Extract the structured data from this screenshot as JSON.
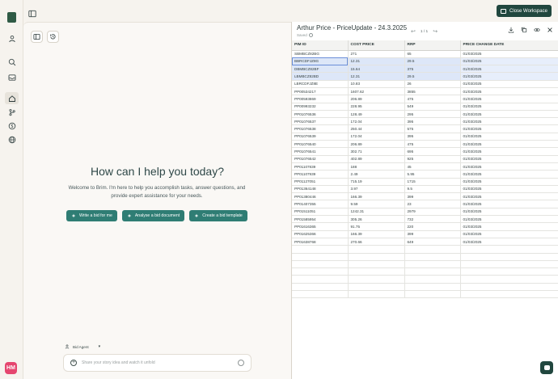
{
  "app": {
    "header": {
      "close_workspace_label": "Close Workspace"
    },
    "user": {
      "initials": "HM"
    }
  },
  "chat": {
    "headline": "How can I help you today?",
    "subtext": "Welcome to Brim. I'm here to help you accomplish tasks, answer questions, and provide expert assistance for your needs.",
    "actions": [
      {
        "label": "Write a bid for me"
      },
      {
        "label": "Analyse a bid document"
      },
      {
        "label": "Create a bid template"
      }
    ],
    "agent_label": "Bid Agent",
    "input_placeholder": "Share your story idea and watch it unfold"
  },
  "panel": {
    "title": "Arthur Price - PriceUpdate - 24.3.2025",
    "status": "Saved",
    "pagination": "1 / 1",
    "columns": [
      "PIM ID",
      "COST PRICE",
      "RRP",
      "PRICE CHANGE DATE"
    ],
    "rows": [
      [
        "SBMBCZ82BG",
        "271",
        "65",
        "01/03/2025"
      ],
      [
        "BBRCDFJZ8G",
        "12.31",
        "29.5",
        "01/03/2025"
      ],
      [
        "DBMBCZ82BF",
        "15.64",
        "375",
        "01/03/2025"
      ],
      [
        "LBMBCZ82BD",
        "12.31",
        "29.5",
        "01/03/2025"
      ],
      [
        "LBRCDFJZ8E",
        "10.83",
        "26",
        "01/03/2025"
      ],
      [
        "PP00534217",
        "1607.62",
        "3855",
        "01/03/2025"
      ],
      [
        "PP00593869",
        "206.89",
        "475",
        "01/03/2025"
      ],
      [
        "PP00993232",
        "228.95",
        "549",
        "01/03/2025"
      ],
      [
        "PP01076536",
        "128.49",
        "295",
        "01/03/2025"
      ],
      [
        "PP01076537",
        "172.04",
        "395",
        "01/03/2025"
      ],
      [
        "PP01076538",
        "250.44",
        "575",
        "01/03/2025"
      ],
      [
        "PP01076539",
        "172.04",
        "395",
        "01/03/2025"
      ],
      [
        "PP01076540",
        "206.89",
        "475",
        "01/03/2025"
      ],
      [
        "PP01076541",
        "302.71",
        "695",
        "01/03/2025"
      ],
      [
        "PP01076542",
        "402.89",
        "925",
        "01/03/2025"
      ],
      [
        "PP01107839",
        "188",
        "45",
        "01/03/2025"
      ],
      [
        "PP01107939",
        "2.49",
        "5.95",
        "01/03/2025"
      ],
      [
        "PP01127051",
        "715.19",
        "1715",
        "01/03/2025"
      ],
      [
        "PP01364148",
        "3.97",
        "9.5",
        "01/03/2025"
      ],
      [
        "PP01380446",
        "166.39",
        "399",
        "01/03/2025"
      ],
      [
        "PP01407355",
        "9.59",
        "23",
        "01/03/2025"
      ],
      [
        "PP01511051",
        "1242.31",
        "2979",
        "01/03/2025"
      ],
      [
        "PP01585954",
        "305.26",
        "732",
        "01/03/2025"
      ],
      [
        "PP01616365",
        "91.75",
        "220",
        "01/03/2025"
      ],
      [
        "PP01625366",
        "166.39",
        "399",
        "01/03/2025"
      ],
      [
        "PP01638768",
        "270.66",
        "649",
        "01/03/2025"
      ]
    ],
    "selected_rows": [
      1,
      2,
      3
    ],
    "empty_rows": 7
  },
  "colors": {
    "brand": "#21473f",
    "action": "#2f7d74",
    "avatar": "#e5466f",
    "selection": "#e7eefb"
  }
}
